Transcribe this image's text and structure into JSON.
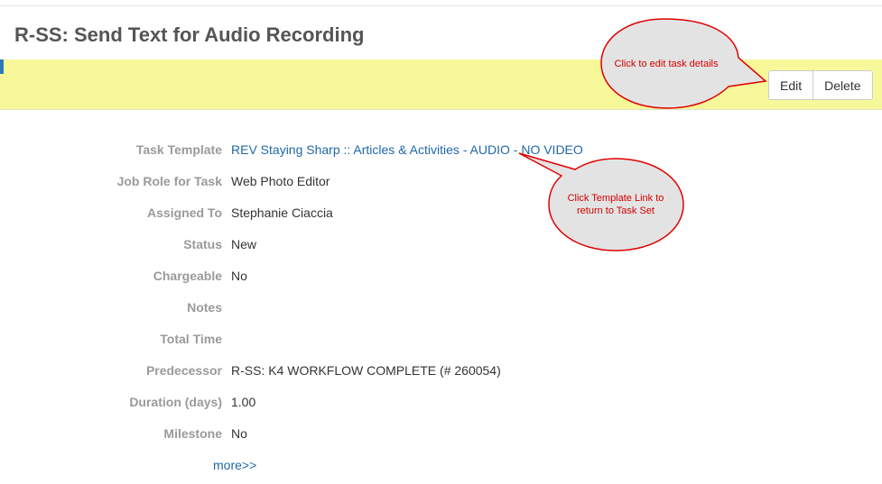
{
  "page": {
    "title": "R-SS: Send Text for Audio Recording"
  },
  "toolbar": {
    "edit_label": "Edit",
    "delete_label": "Delete"
  },
  "details": {
    "task_template": {
      "label": "Task Template",
      "value": "REV Staying Sharp :: Articles & Activities - AUDIO - NO VIDEO"
    },
    "job_role": {
      "label": "Job Role for Task",
      "value": "Web Photo Editor"
    },
    "assigned_to": {
      "label": "Assigned To",
      "value": "Stephanie Ciaccia"
    },
    "status": {
      "label": "Status",
      "value": "New"
    },
    "chargeable": {
      "label": "Chargeable",
      "value": "No"
    },
    "notes": {
      "label": "Notes",
      "value": ""
    },
    "total_time": {
      "label": "Total Time",
      "value": ""
    },
    "predecessor": {
      "label": "Predecessor",
      "value": "R-SS: K4 WORKFLOW COMPLETE (# 260054)"
    },
    "duration": {
      "label": "Duration (days)",
      "value": "1.00"
    },
    "milestone": {
      "label": "Milestone",
      "value": "No"
    },
    "more_label": "more>>"
  },
  "annotations": {
    "edit_callout": "Click to edit task details",
    "template_callout": "Click Template Link to return to Task Set"
  },
  "colors": {
    "toolbar_bg": "#f6f89a",
    "link": "#1f68a8",
    "callout_fill": "#e3e3e3",
    "callout_stroke": "#e00000",
    "callout_text": "#d40000"
  }
}
